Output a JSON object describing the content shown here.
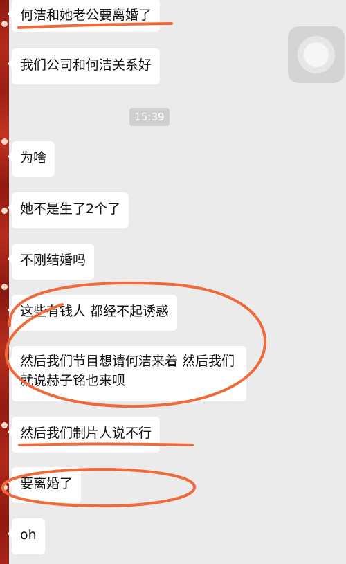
{
  "timestamp": "15:39",
  "messages": [
    {
      "text": "何洁和她老公要离婚了"
    },
    {
      "text": "我们公司和何洁关系好"
    },
    {
      "text": "为啥"
    },
    {
      "text": "她不是生了2个了"
    },
    {
      "text": "不刚结婚吗"
    },
    {
      "text": "这些有钱人 都经不起诱惑"
    },
    {
      "text": "然后我们节目想请何洁来着 然后我们就说赫子铭也来呗"
    },
    {
      "text": "然后我们制片人说不行"
    },
    {
      "text": "要离婚了"
    },
    {
      "text": "oh"
    }
  ],
  "annotation_color": "#ee6a3a"
}
